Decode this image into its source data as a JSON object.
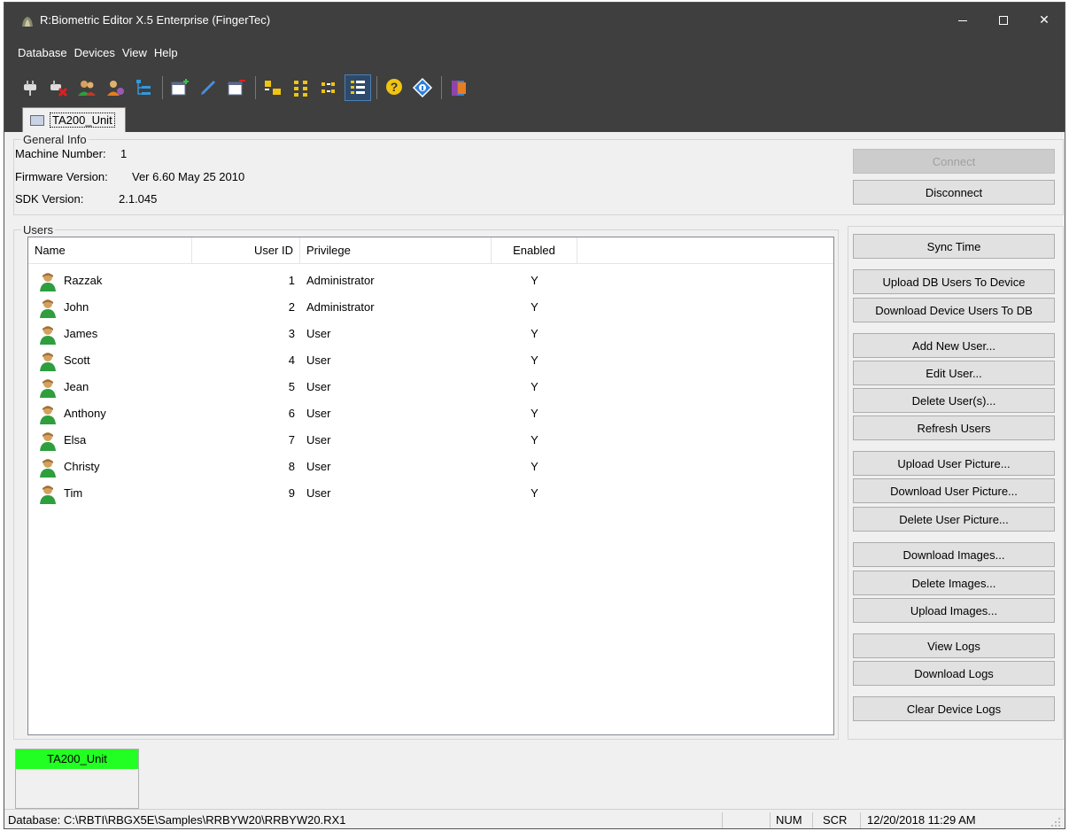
{
  "window": {
    "title": "R:Biometric Editor X.5 Enterprise (FingerTec)",
    "controls": {
      "minimize": "minimize",
      "maximize": "maximize",
      "close": "✕"
    }
  },
  "menu": [
    "Database",
    "Devices",
    "View",
    "Help"
  ],
  "toolbar_icons": [
    "connect-plug-icon",
    "disconnect-plug-icon",
    "users-icon",
    "user-settings-icon",
    "tree-view-icon",
    "add-record-icon",
    "edit-pencil-icon",
    "delete-record-icon",
    "large-icons-view-icon",
    "small-icons-view-icon",
    "list-view-icon",
    "details-view-icon",
    "help-icon",
    "about-icon",
    "exit-icon"
  ],
  "document_tab": {
    "label": "TA200_Unit"
  },
  "general_info": {
    "title": "General Info",
    "machine_number_label": "Machine Number:",
    "machine_number_value": "1",
    "firmware_label": "Firmware Version:",
    "firmware_value": "Ver 6.60 May 25 2010",
    "sdk_label": "SDK Version:",
    "sdk_value": "2.1.045"
  },
  "users": {
    "title": "Users",
    "columns": {
      "name": "Name",
      "user_id": "User ID",
      "privilege": "Privilege",
      "enabled": "Enabled"
    },
    "rows": [
      {
        "name": "Razzak",
        "user_id": "1",
        "privilege": "Administrator",
        "enabled": "Y"
      },
      {
        "name": "John",
        "user_id": "2",
        "privilege": "Administrator",
        "enabled": "Y"
      },
      {
        "name": "James",
        "user_id": "3",
        "privilege": "User",
        "enabled": "Y"
      },
      {
        "name": "Scott",
        "user_id": "4",
        "privilege": "User",
        "enabled": "Y"
      },
      {
        "name": "Jean",
        "user_id": "5",
        "privilege": "User",
        "enabled": "Y"
      },
      {
        "name": "Anthony",
        "user_id": "6",
        "privilege": "User",
        "enabled": "Y"
      },
      {
        "name": "Elsa",
        "user_id": "7",
        "privilege": "User",
        "enabled": "Y"
      },
      {
        "name": "Christy",
        "user_id": "8",
        "privilege": "User",
        "enabled": "Y"
      },
      {
        "name": "Tim",
        "user_id": "9",
        "privilege": "User",
        "enabled": "Y"
      }
    ]
  },
  "buttons": {
    "connect": "Connect",
    "disconnect": "Disconnect",
    "sync_time": "Sync Time",
    "upload_db_users": "Upload DB Users To Device",
    "download_device_users": "Download Device Users To DB",
    "add_new_user": "Add New User...",
    "edit_user": "Edit User...",
    "delete_users": "Delete User(s)...",
    "refresh_users": "Refresh Users",
    "upload_user_picture": "Upload User Picture...",
    "download_user_picture": "Download User Picture...",
    "delete_user_picture": "Delete User Picture...",
    "download_images": "Download Images...",
    "delete_images": "Delete Images...",
    "upload_images": "Upload Images...",
    "view_logs": "View Logs",
    "download_logs": "Download Logs",
    "clear_device_logs": "Clear Device Logs"
  },
  "unit_panel": {
    "label": "TA200_Unit",
    "status_color": "#22ff22"
  },
  "status_bar": {
    "database_path": "Database: C:\\RBTI\\RBGX5E\\Samples\\RRBYW20\\RRBYW20.RX1",
    "num": "NUM",
    "scr": "SCR",
    "datetime": "12/20/2018 11:29 AM"
  }
}
